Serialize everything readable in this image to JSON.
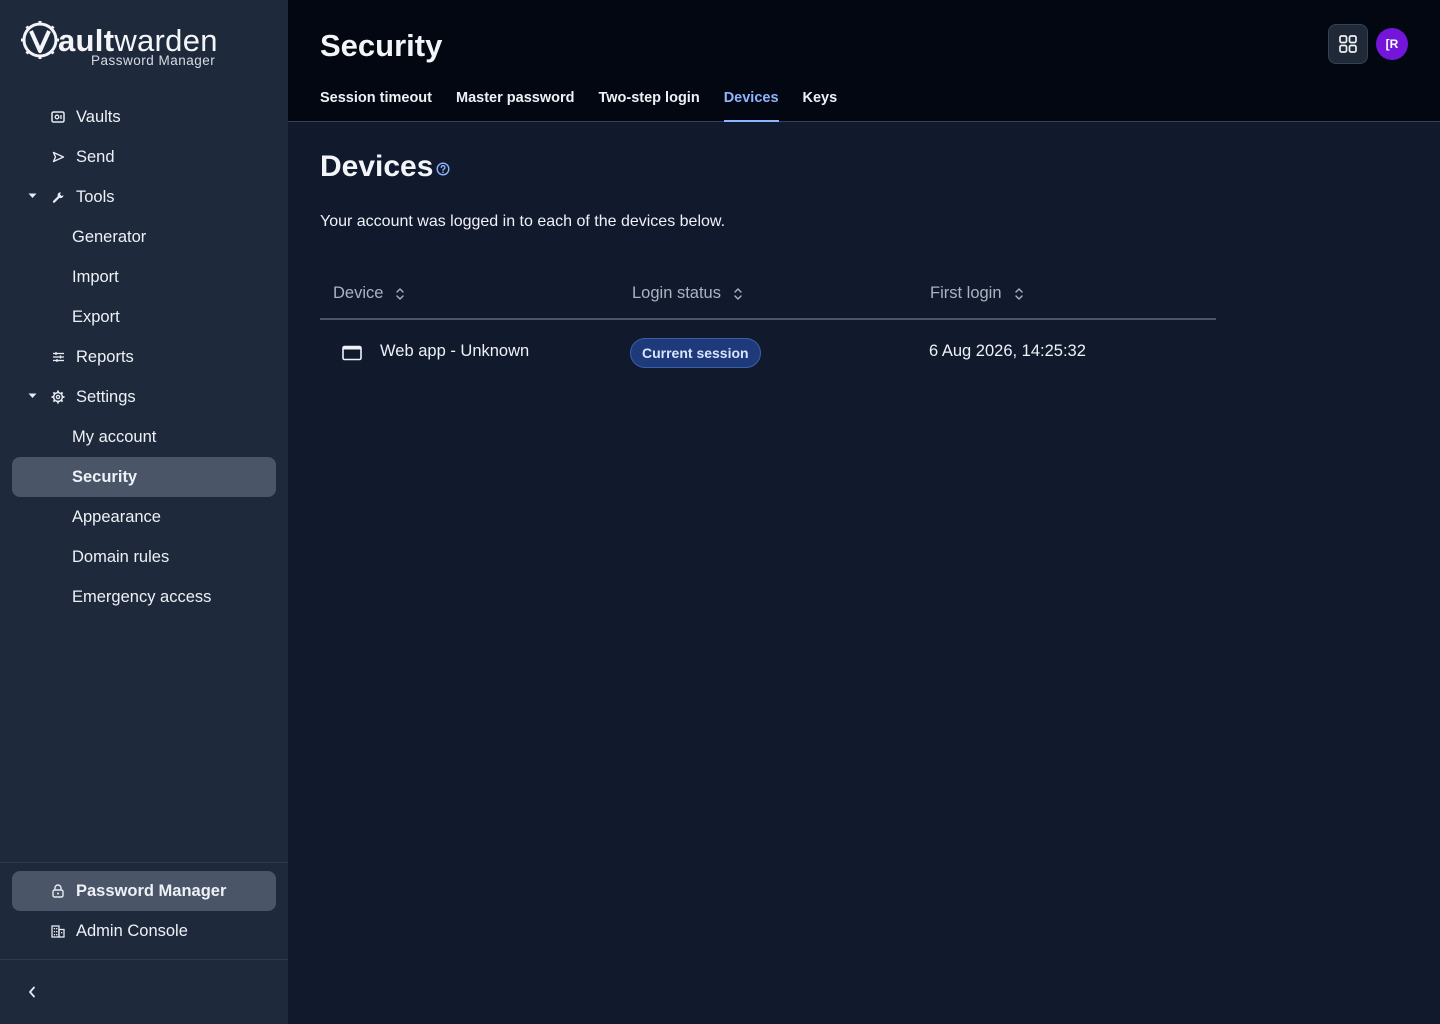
{
  "brand": {
    "name_bold": "ault",
    "name_rest": "warden",
    "subtitle": "Password Manager"
  },
  "sidebar": {
    "items": [
      {
        "label": "Vaults",
        "icon": "vault-icon"
      },
      {
        "label": "Send",
        "icon": "send-icon"
      },
      {
        "label": "Tools",
        "icon": "wrench-icon",
        "expanded": true
      },
      {
        "label": "Generator"
      },
      {
        "label": "Import"
      },
      {
        "label": "Export"
      },
      {
        "label": "Reports",
        "icon": "sliders-icon"
      },
      {
        "label": "Settings",
        "icon": "gear-icon",
        "expanded": true
      },
      {
        "label": "My account"
      },
      {
        "label": "Security",
        "active": true
      },
      {
        "label": "Appearance"
      },
      {
        "label": "Domain rules"
      },
      {
        "label": "Emergency access"
      }
    ],
    "footer": [
      {
        "label": "Password Manager",
        "icon": "lock-icon",
        "active": true
      },
      {
        "label": "Admin Console",
        "icon": "building-icon"
      }
    ]
  },
  "header": {
    "title": "Security",
    "tabs": [
      {
        "label": "Session timeout"
      },
      {
        "label": "Master password"
      },
      {
        "label": "Two-step login"
      },
      {
        "label": "Devices",
        "active": true
      },
      {
        "label": "Keys"
      }
    ],
    "avatar_initials": "[R"
  },
  "main": {
    "title": "Devices",
    "description": "Your account was logged in to each of the devices below.",
    "columns": [
      "Device",
      "Login status",
      "First login"
    ],
    "rows": [
      {
        "device": "Web app - Unknown",
        "status": "Current session",
        "first_login": "6 Aug 2026, 14:25:32"
      }
    ]
  },
  "colors": {
    "accent": "#8fb4ff",
    "sidebar_bg": "#1e293b",
    "header_bg": "#030712",
    "main_bg": "#111a2c",
    "avatar": "#7316d9",
    "badge_bg": "#1e3a7a"
  }
}
